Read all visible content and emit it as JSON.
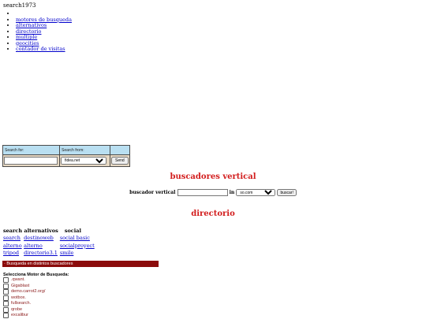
{
  "site_title": "search1973",
  "nav": [
    {
      "label": "motores de busqueda"
    },
    {
      "label": "alternativos"
    },
    {
      "label": "directorio"
    },
    {
      "label": "multiple"
    },
    {
      "label": "geocities"
    },
    {
      "label": "contador de visitas"
    }
  ],
  "search_box": {
    "search_for_label": "Search for:",
    "search_from_label": "Search from:",
    "query_value": "",
    "source_selected": "fidea.net",
    "send_label": "Send"
  },
  "vertical": {
    "heading": "buscadores vertical",
    "label": "buscador vertical",
    "query_value": "",
    "in_label": "in",
    "selected": "so.com",
    "button_label": "buscar!"
  },
  "directorio_heading": "directorio",
  "links_table": {
    "headers": [
      "search alternativos",
      "social"
    ],
    "rows": [
      [
        "search",
        "destinoweb",
        "social basic"
      ],
      [
        "alterno",
        "alterno",
        "socialproyect"
      ],
      [
        "tripod",
        "directorio3.1",
        "smile"
      ]
    ]
  },
  "multi": {
    "bar_title": "· Busqueda en distintos buscadores",
    "select_label": "Selecciona Motor de Busqueda:",
    "engines": [
      ".qwant.",
      "Gigablast",
      "demo.carrot2.org/",
      "wotbox.",
      "fullsearch.",
      "qrobe",
      "excalibur"
    ]
  },
  "colors": {
    "accent_red": "#d21c1c",
    "bar_red": "#8b0b0b",
    "link_blue": "#0000cc",
    "search_header_blue": "#b9dff1",
    "search_body_tan": "#e6d8c3"
  }
}
